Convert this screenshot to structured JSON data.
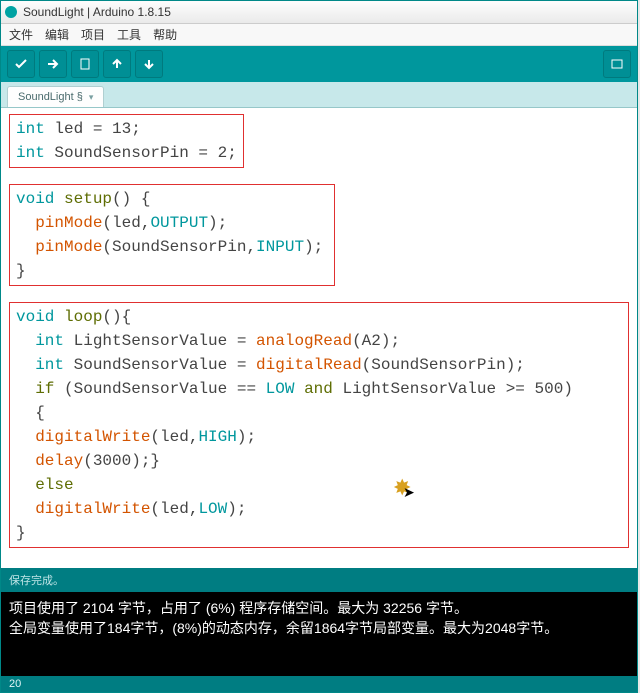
{
  "titlebar": {
    "text": "SoundLight | Arduino 1.8.15"
  },
  "menubar": [
    "文件",
    "编辑",
    "项目",
    "工具",
    "帮助"
  ],
  "toolbar_icons": [
    "check",
    "arrow-right",
    "new",
    "open",
    "save"
  ],
  "tab": {
    "label": "SoundLight §"
  },
  "code": {
    "block1": {
      "l1": {
        "t1": "int ",
        "t2": "led = 13;"
      },
      "l2": {
        "t1": "int ",
        "t2": "SoundSensorPin = 2;"
      }
    },
    "block2": {
      "l1": {
        "t1": "void ",
        "t2": "setup",
        "t3": "() {"
      },
      "l2": {
        "t1": "pinMode",
        "t2": "(led,",
        "t3": "OUTPUT",
        "t4": ");"
      },
      "l3": {
        "t1": "pinMode",
        "t2": "(SoundSensorPin,",
        "t3": "INPUT",
        "t4": ");"
      },
      "l4": "}"
    },
    "block3": {
      "l1": {
        "t1": "void ",
        "t2": "loop",
        "t3": "(){"
      },
      "l2": {
        "t1": "int ",
        "t2": "LightSensorValue = ",
        "t3": "analogRead",
        "t4": "(A2);"
      },
      "l3": {
        "t1": "int ",
        "t2": "SoundSensorValue = ",
        "t3": "digitalRead",
        "t4": "(SoundSensorPin);"
      },
      "blank1": " ",
      "l4": {
        "t1": "if ",
        "t2": "(SoundSensorValue == ",
        "t3": "LOW",
        "t4": " and",
        "t5": " LightSensorValue >= 500)"
      },
      "l5": "{",
      "l6": {
        "t1": "digitalWrite",
        "t2": "(led,",
        "t3": "HIGH",
        "t4": ");"
      },
      "l7": {
        "t1": "delay",
        "t2": "(3000);}"
      },
      "l8": "else",
      "l9": {
        "t1": "digitalWrite",
        "t2": "(led,",
        "t3": "LOW",
        "t4": ");"
      },
      "l10": "}"
    }
  },
  "status": {
    "message": "保存完成。"
  },
  "console": "项目使用了 2104 字节，占用了 (6%) 程序存储空间。最大为 32256 字节。\n全局变量使用了184字节，(8%)的动态内存，余留1864字节局部变量。最大为2048字节。",
  "footbar": {
    "line": "20"
  }
}
